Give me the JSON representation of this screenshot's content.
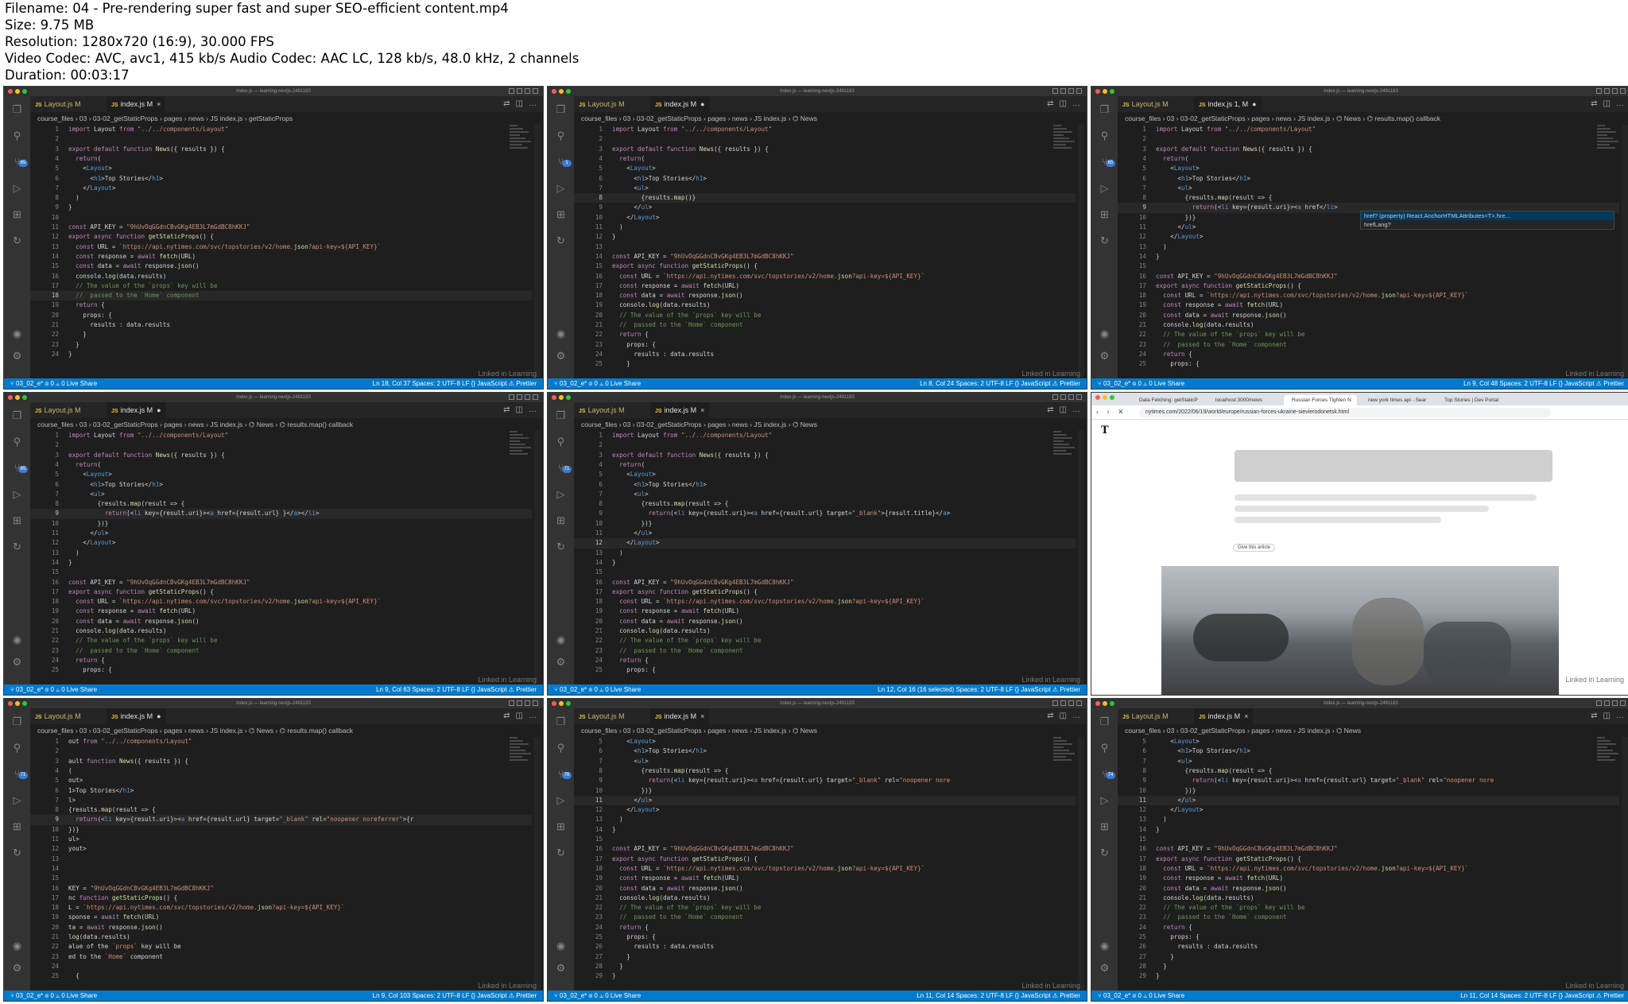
{
  "meta": {
    "filename": "Filename: 04 - Pre-rendering super fast and super SEO-efficient content.mp4",
    "size": "Size: 9.75 MB",
    "resolution": "Resolution: 1280x720 (16:9), 30.000 FPS",
    "codec": "Video Codec: AVC, avc1, 415 kb/s Audio Codec: AAC LC, 128 kb/s, 48.0 kHz, 2 channels",
    "duration": "Duration: 00:03:17"
  },
  "editor": {
    "window_title": "index.js — learning-nextjs-2491183",
    "tab_layout": "Layout.js M",
    "tab_index": "index.js M",
    "tab_index_err": "index.js 1, M",
    "breadcrumb_base": "course_files › 03 › 03-02_getStaticProps › pages › news › JS index.js",
    "watermark": "Linked in Learning",
    "status_left": "⑂ 03_02_e*   ⊗ 0 ⚠ 0   Live Share",
    "status_enc": "Spaces: 2   UTF-8   LF   {} JavaScript   ⚠ Prettier"
  },
  "frames": [
    {
      "breadcrumb_tail": " › getStaticProps",
      "active_tab": "index.js M",
      "tab_mark": "×",
      "status_pos": "Ln 18, Col 37",
      "current_line": 18,
      "badge": "65",
      "lines": [
        {
          "n": 1,
          "t": "import Layout from \"../../components/Layout\""
        },
        {
          "n": 2,
          "t": ""
        },
        {
          "n": 3,
          "t": "export default function News({ results }) {"
        },
        {
          "n": 4,
          "t": "  return("
        },
        {
          "n": 5,
          "t": "    <Layout>"
        },
        {
          "n": 6,
          "t": "      <h1>Top Stories</h1>"
        },
        {
          "n": 7,
          "t": "    </Layout>"
        },
        {
          "n": 8,
          "t": "  )"
        },
        {
          "n": 9,
          "t": "}"
        },
        {
          "n": 10,
          "t": ""
        },
        {
          "n": 11,
          "t": "const API_KEY = \"9hUvOqGGdnCBvGKg4EB3L7mGdBC8hKKJ\""
        },
        {
          "n": 12,
          "t": "export async function getStaticProps() {"
        },
        {
          "n": 13,
          "t": "  const URL = `https://api.nytimes.com/svc/topstories/v2/home.json?api-key=${API_KEY}`"
        },
        {
          "n": 14,
          "t": "  const response = await fetch(URL)"
        },
        {
          "n": 15,
          "t": "  const data = await response.json()"
        },
        {
          "n": 16,
          "t": "  console.log(data.results)"
        },
        {
          "n": 17,
          "t": "  // The value of the `props` key will be"
        },
        {
          "n": 18,
          "t": "  //  passed to the `Home` component"
        },
        {
          "n": 19,
          "t": "  return {"
        },
        {
          "n": 20,
          "t": "    props: {"
        },
        {
          "n": 21,
          "t": "      results : data.results"
        },
        {
          "n": 22,
          "t": "    }"
        },
        {
          "n": 23,
          "t": "  }"
        },
        {
          "n": 24,
          "t": "}"
        }
      ]
    },
    {
      "breadcrumb_tail": " › ⌬ News",
      "active_tab": "index.js M",
      "tab_mark": "●",
      "status_pos": "Ln 8, Col 24",
      "current_line": 8,
      "badge": "1",
      "lines": [
        {
          "n": 1,
          "t": "import Layout from \"../../components/Layout\""
        },
        {
          "n": 2,
          "t": ""
        },
        {
          "n": 3,
          "t": "export default function News({ results }) {"
        },
        {
          "n": 4,
          "t": "  return("
        },
        {
          "n": 5,
          "t": "    <Layout>"
        },
        {
          "n": 6,
          "t": "      <h1>Top Stories</h1>"
        },
        {
          "n": 7,
          "t": "      <ul>"
        },
        {
          "n": 8,
          "t": "        {results.map()}"
        },
        {
          "n": 9,
          "t": "      </ul>"
        },
        {
          "n": 10,
          "t": "    </Layout>"
        },
        {
          "n": 11,
          "t": "  )"
        },
        {
          "n": 12,
          "t": "}"
        },
        {
          "n": 13,
          "t": ""
        },
        {
          "n": 14,
          "t": "const API_KEY = \"9hUvOqGGdnCBvGKg4EB3L7mGdBC8hKKJ\""
        },
        {
          "n": 15,
          "t": "export async function getStaticProps() {"
        },
        {
          "n": 16,
          "t": "  const URL = `https://api.nytimes.com/svc/topstories/v2/home.json?api-key=${API_KEY}`"
        },
        {
          "n": 17,
          "t": "  const response = await fetch(URL)"
        },
        {
          "n": 18,
          "t": "  const data = await response.json()"
        },
        {
          "n": 19,
          "t": "  console.log(data.results)"
        },
        {
          "n": 20,
          "t": "  // The value of the `props` key will be"
        },
        {
          "n": 21,
          "t": "  //  passed to the `Home` component"
        },
        {
          "n": 22,
          "t": "  return {"
        },
        {
          "n": 23,
          "t": "    props: {"
        },
        {
          "n": 24,
          "t": "      results : data.results"
        },
        {
          "n": 25,
          "t": "    }"
        }
      ]
    },
    {
      "breadcrumb_tail": " › ⌬ News › ⌬ results.map() callback",
      "active_tab": "index.js 1, M",
      "tab_mark": "●",
      "status_pos": "Ln 9, Col 48",
      "current_line": 9,
      "badge": "65",
      "lines": [
        {
          "n": 1,
          "t": "import Layout from \"../../components/Layout\""
        },
        {
          "n": 2,
          "t": ""
        },
        {
          "n": 3,
          "t": "export default function News({ results }) {"
        },
        {
          "n": 4,
          "t": "  return("
        },
        {
          "n": 5,
          "t": "    <Layout>"
        },
        {
          "n": 6,
          "t": "      <h1>Top Stories</h1>"
        },
        {
          "n": 7,
          "t": "      <ul>"
        },
        {
          "n": 8,
          "t": "        {results.map(result => {"
        },
        {
          "n": 9,
          "t": "          return(<li key={result.uri}><a href</li>"
        },
        {
          "n": 10,
          "t": "        })}"
        },
        {
          "n": 11,
          "t": "      </ul>"
        },
        {
          "n": 12,
          "t": "    </Layout>"
        },
        {
          "n": 13,
          "t": "  )"
        },
        {
          "n": 14,
          "t": "}"
        },
        {
          "n": 15,
          "t": ""
        },
        {
          "n": 16,
          "t": "const API_KEY = \"9hUvOqGGdnCBvGKg4EB3L7mGdBC8hKKJ\""
        },
        {
          "n": 17,
          "t": "export async function getStaticProps() {"
        },
        {
          "n": 18,
          "t": "  const URL = `https://api.nytimes.com/svc/topstories/v2/home.json?api-key=${API_KEY}`"
        },
        {
          "n": 19,
          "t": "  const response = await fetch(URL)"
        },
        {
          "n": 20,
          "t": "  const data = await response.json()"
        },
        {
          "n": 21,
          "t": "  console.log(data.results)"
        },
        {
          "n": 22,
          "t": "  // The value of the `props` key will be"
        },
        {
          "n": 23,
          "t": "  //  passed to the `Home` component"
        },
        {
          "n": 24,
          "t": "  return {"
        },
        {
          "n": 25,
          "t": "    props: {"
        }
      ],
      "suggest": [
        "href?        (property) React.AnchorHTMLAttributes<T>.hre...",
        "hrefLang?"
      ]
    },
    {
      "breadcrumb_tail": " › ⌬ News › ⌬ results.map() callback",
      "active_tab": "index.js M",
      "tab_mark": "●",
      "status_pos": "Ln 9, Col 63",
      "current_line": 9,
      "badge": "65",
      "lines": [
        {
          "n": 1,
          "t": "import Layout from \"../../components/Layout\""
        },
        {
          "n": 2,
          "t": ""
        },
        {
          "n": 3,
          "t": "export default function News({ results }) {"
        },
        {
          "n": 4,
          "t": "  return("
        },
        {
          "n": 5,
          "t": "    <Layout>"
        },
        {
          "n": 6,
          "t": "      <h1>Top Stories</h1>"
        },
        {
          "n": 7,
          "t": "      <ul>"
        },
        {
          "n": 8,
          "t": "        {results.map(result => {"
        },
        {
          "n": 9,
          "t": "          return(<li key={result.uri}><a href={result.url} }</a></li>"
        },
        {
          "n": 10,
          "t": "        })}"
        },
        {
          "n": 11,
          "t": "      </ul>"
        },
        {
          "n": 12,
          "t": "    </Layout>"
        },
        {
          "n": 13,
          "t": "  )"
        },
        {
          "n": 14,
          "t": "}"
        },
        {
          "n": 15,
          "t": ""
        },
        {
          "n": 16,
          "t": "const API_KEY = \"9hUvOqGGdnCBvGKg4EB3L7mGdBC8hKKJ\""
        },
        {
          "n": 17,
          "t": "export async function getStaticProps() {"
        },
        {
          "n": 18,
          "t": "  const URL = `https://api.nytimes.com/svc/topstories/v2/home.json?api-key=${API_KEY}`"
        },
        {
          "n": 19,
          "t": "  const response = await fetch(URL)"
        },
        {
          "n": 20,
          "t": "  const data = await response.json()"
        },
        {
          "n": 21,
          "t": "  console.log(data.results)"
        },
        {
          "n": 22,
          "t": "  // The value of the `props` key will be"
        },
        {
          "n": 23,
          "t": "  //  passed to the `Home` component"
        },
        {
          "n": 24,
          "t": "  return {"
        },
        {
          "n": 25,
          "t": "    props: {"
        }
      ]
    },
    {
      "breadcrumb_tail": " › ⌬ News",
      "active_tab": "index.js M",
      "tab_mark": "×",
      "status_pos": "Ln 12, Col 16 (16 selected)",
      "current_line": 12,
      "badge": "71",
      "lines": [
        {
          "n": 1,
          "t": "import Layout from \"../../components/Layout\""
        },
        {
          "n": 2,
          "t": ""
        },
        {
          "n": 3,
          "t": "export default function News({ results }) {"
        },
        {
          "n": 4,
          "t": "  return("
        },
        {
          "n": 5,
          "t": "    <Layout>"
        },
        {
          "n": 6,
          "t": "      <h1>Top Stories</h1>"
        },
        {
          "n": 7,
          "t": "      <ul>"
        },
        {
          "n": 8,
          "t": "        {results.map(result => {"
        },
        {
          "n": 9,
          "t": "          return(<li key={result.uri}><a href={result.url} target=\"_blank\">{result.title}</a>"
        },
        {
          "n": 10,
          "t": "        })}"
        },
        {
          "n": 11,
          "t": "      </ul>"
        },
        {
          "n": 12,
          "t": "    </Layout>"
        },
        {
          "n": 13,
          "t": "  )"
        },
        {
          "n": 14,
          "t": "}"
        },
        {
          "n": 15,
          "t": ""
        },
        {
          "n": 16,
          "t": "const API_KEY = \"9hUvOqGGdnCBvGKg4EB3L7mGdBC8hKKJ\""
        },
        {
          "n": 17,
          "t": "export async function getStaticProps() {"
        },
        {
          "n": 18,
          "t": "  const URL = `https://api.nytimes.com/svc/topstories/v2/home.json?api-key=${API_KEY}`"
        },
        {
          "n": 19,
          "t": "  const response = await fetch(URL)"
        },
        {
          "n": 20,
          "t": "  const data = await response.json()"
        },
        {
          "n": 21,
          "t": "  console.log(data.results)"
        },
        {
          "n": 22,
          "t": "  // The value of the `props` key will be"
        },
        {
          "n": 23,
          "t": "  //  passed to the `Home` component"
        },
        {
          "n": 24,
          "t": "  return {"
        },
        {
          "n": 25,
          "t": "    props: {"
        }
      ]
    },
    {
      "browser": true,
      "tabs": [
        "Data Fetching: getStaticP",
        "localhost:3000/news",
        "Russian Forces Tighten N",
        "new york times api - Sear",
        "Top Stories | Dev Portal"
      ],
      "url": "nytimes.com/2022/06/19/world/europe/russian-forces-ukraine-sievierodonetsk.html",
      "logo": "T",
      "save_label": "Give this article"
    },
    {
      "breadcrumb_tail": " › ⌬ News › ⌬ results.map() callback",
      "active_tab": "index.js M",
      "tab_mark": "●",
      "status_pos": "Ln 9, Col 103",
      "current_line": 9,
      "badge": "71",
      "lines": [
        {
          "n": 1,
          "t": "out from \"../../components/Layout\""
        },
        {
          "n": 2,
          "t": ""
        },
        {
          "n": 3,
          "t": "ault function News({ results }) {"
        },
        {
          "n": 4,
          "t": "("
        },
        {
          "n": 5,
          "t": "out>"
        },
        {
          "n": 6,
          "t": "1>Top Stories</h1>"
        },
        {
          "n": 7,
          "t": "l>"
        },
        {
          "n": 8,
          "t": "{results.map(result => {"
        },
        {
          "n": 9,
          "t": "  return(<li key={result.uri}><a href={result.url} target=\"_blank\" rel=\"noopener noreferrer\">{r"
        },
        {
          "n": 10,
          "t": "})}"
        },
        {
          "n": 11,
          "t": "ul>"
        },
        {
          "n": 12,
          "t": "yout>"
        },
        {
          "n": 13,
          "t": ""
        },
        {
          "n": 14,
          "t": ""
        },
        {
          "n": 15,
          "t": ""
        },
        {
          "n": 16,
          "t": "KEY = \"9hUvOqGGdnCBvGKg4EB3L7mGdBC8hKKJ\""
        },
        {
          "n": 17,
          "t": "nc function getStaticProps() {"
        },
        {
          "n": 18,
          "t": "L = `https://api.nytimes.com/svc/topstories/v2/home.json?api-key=${API_KEY}`"
        },
        {
          "n": 19,
          "t": "sponse = await fetch(URL)"
        },
        {
          "n": 20,
          "t": "ta = await response.json()"
        },
        {
          "n": 21,
          "t": "log(data.results)"
        },
        {
          "n": 22,
          "t": "alue of the `props` key will be"
        },
        {
          "n": 23,
          "t": "ed to the `Home` component"
        },
        {
          "n": 24,
          "t": ""
        },
        {
          "n": 25,
          "t": "  {"
        }
      ]
    },
    {
      "breadcrumb_tail": " › ⌬ News",
      "active_tab": "index.js M",
      "tab_mark": "×",
      "status_pos": "Ln 11, Col 14",
      "current_line": 11,
      "badge": "76",
      "lines": [
        {
          "n": 5,
          "t": "    <Layout>"
        },
        {
          "n": 6,
          "t": "      <h1>Top Stories</h1>"
        },
        {
          "n": 7,
          "t": "      <ul>"
        },
        {
          "n": 8,
          "t": "        {results.map(result => {"
        },
        {
          "n": 9,
          "t": "          return(<li key={result.uri}><a href={result.url} target=\"_blank\" rel=\"noopener nore"
        },
        {
          "n": 10,
          "t": "        })}"
        },
        {
          "n": 11,
          "t": "      </ul>"
        },
        {
          "n": 12,
          "t": "    </Layout>"
        },
        {
          "n": 13,
          "t": "  )"
        },
        {
          "n": 14,
          "t": "}"
        },
        {
          "n": 15,
          "t": ""
        },
        {
          "n": 16,
          "t": "const API_KEY = \"9hUvOqGGdnCBvGKg4EB3L7mGdBC8hKKJ\""
        },
        {
          "n": 17,
          "t": "export async function getStaticProps() {"
        },
        {
          "n": 18,
          "t": "  const URL = `https://api.nytimes.com/svc/topstories/v2/home.json?api-key=${API_KEY}`"
        },
        {
          "n": 19,
          "t": "  const response = await fetch(URL)"
        },
        {
          "n": 20,
          "t": "  const data = await response.json()"
        },
        {
          "n": 21,
          "t": "  console.log(data.results)"
        },
        {
          "n": 22,
          "t": "  // The value of the `props` key will be"
        },
        {
          "n": 23,
          "t": "  //  passed to the `Home` component"
        },
        {
          "n": 24,
          "t": "  return {"
        },
        {
          "n": 25,
          "t": "    props: {"
        },
        {
          "n": 26,
          "t": "      results : data.results"
        },
        {
          "n": 27,
          "t": "    }"
        },
        {
          "n": 28,
          "t": "  }"
        },
        {
          "n": 29,
          "t": "}"
        }
      ]
    },
    {
      "breadcrumb_tail": " › ⌬ News",
      "active_tab": "index.js M",
      "tab_mark": "×",
      "status_pos": "Ln 11, Col 14",
      "current_line": 11,
      "badge": "74",
      "lines": [
        {
          "n": 5,
          "t": "    <Layout>"
        },
        {
          "n": 6,
          "t": "      <h1>Top Stories</h1>"
        },
        {
          "n": 7,
          "t": "      <ul>"
        },
        {
          "n": 8,
          "t": "        {results.map(result => {"
        },
        {
          "n": 9,
          "t": "          return(<li key={result.uri}><a href={result.url} target=\"_blank\" rel=\"noopener nore"
        },
        {
          "n": 10,
          "t": "        })}"
        },
        {
          "n": 11,
          "t": "      </ul>"
        },
        {
          "n": 12,
          "t": "    </Layout>"
        },
        {
          "n": 13,
          "t": "  )"
        },
        {
          "n": 14,
          "t": "}"
        },
        {
          "n": 15,
          "t": ""
        },
        {
          "n": 16,
          "t": "const API_KEY = \"9hUvOqGGdnCBvGKg4EB3L7mGdBC8hKKJ\""
        },
        {
          "n": 17,
          "t": "export async function getStaticProps() {"
        },
        {
          "n": 18,
          "t": "  const URL = `https://api.nytimes.com/svc/topstories/v2/home.json?api-key=${API_KEY}`"
        },
        {
          "n": 19,
          "t": "  const response = await fetch(URL)"
        },
        {
          "n": 20,
          "t": "  const data = await response.json()"
        },
        {
          "n": 21,
          "t": "  console.log(data.results)"
        },
        {
          "n": 22,
          "t": "  // The value of the `props` key will be"
        },
        {
          "n": 23,
          "t": "  //  passed to the `Home` component"
        },
        {
          "n": 24,
          "t": "  return {"
        },
        {
          "n": 25,
          "t": "    props: {"
        },
        {
          "n": 26,
          "t": "      results : data.results"
        },
        {
          "n": 27,
          "t": "    }"
        },
        {
          "n": 28,
          "t": "  }"
        },
        {
          "n": 29,
          "t": "}"
        }
      ]
    }
  ]
}
